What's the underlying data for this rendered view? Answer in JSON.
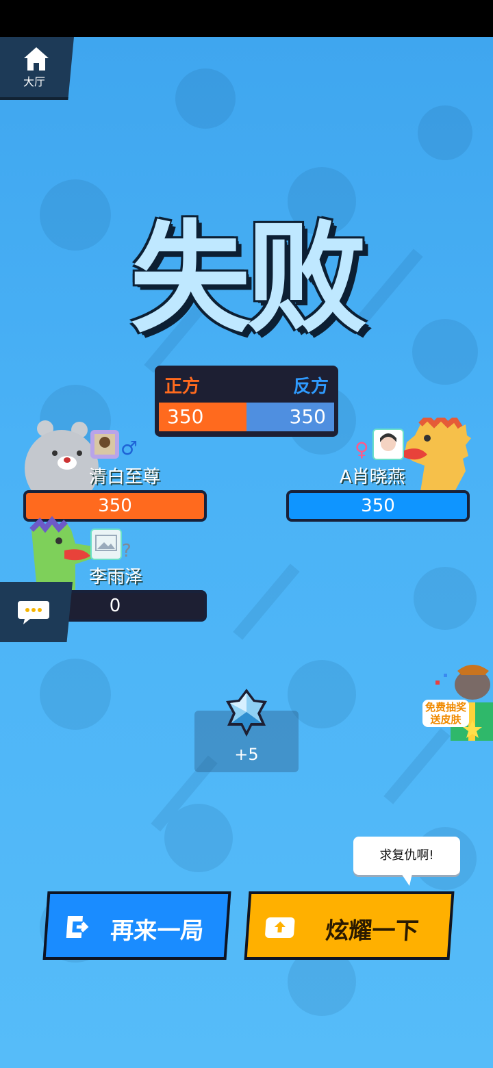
{
  "nav": {
    "home_label": "大厅",
    "home_icon": "home-icon"
  },
  "result": {
    "title": "失败"
  },
  "scoreboard": {
    "team_a": {
      "label": "正方",
      "score": "350",
      "color": "#ff6a1e"
    },
    "team_b": {
      "label": "反方",
      "score": "350",
      "color": "#2f9bff"
    }
  },
  "players": [
    {
      "name": "清白至尊",
      "score": "350",
      "gender": "♂",
      "team": "a",
      "mascot": "bear"
    },
    {
      "name": "A肖晓燕",
      "score": "350",
      "gender": "♀",
      "team": "b",
      "mascot": "dinosaur-orange"
    },
    {
      "name": "李雨泽",
      "score": "0",
      "gender": "?",
      "team": "a",
      "mascot": "dinosaur-green"
    }
  ],
  "reward": {
    "value": "+5",
    "icon": "star-crystal-icon"
  },
  "promo": {
    "label_line1": "免费抽奖",
    "label_line2": "送皮肤"
  },
  "speech_bubble": {
    "text": "求复仇啊!"
  },
  "buttons": {
    "again": "再来一局",
    "share": "炫耀一下"
  },
  "colors": {
    "background": "#4ab2f6",
    "dark_panel": "#1d1f33"
  }
}
